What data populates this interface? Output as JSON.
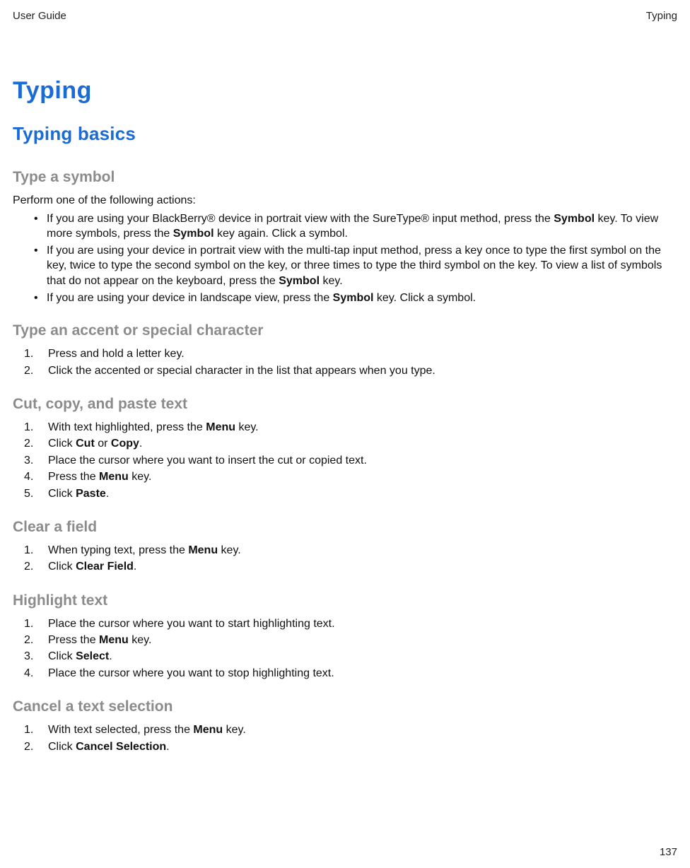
{
  "header": {
    "left": "User Guide",
    "right": "Typing"
  },
  "title": "Typing",
  "section": "Typing basics",
  "blocks": [
    {
      "heading": "Type a symbol",
      "intro": "Perform one of the following actions:",
      "bullets": [
        {
          "segments": [
            {
              "t": "If you are using your BlackBerry® device in portrait view with the SureType® input method, press the "
            },
            {
              "t": "Symbol",
              "b": true
            },
            {
              "t": " key. To view more symbols, press the "
            },
            {
              "t": "Symbol",
              "b": true
            },
            {
              "t": " key again. Click a symbol."
            }
          ]
        },
        {
          "segments": [
            {
              "t": "If you are using your device in portrait view with the multi-tap input method, press a key once to type the first symbol on the key, twice to type the second symbol on the key, or three times to type the third symbol on the key. To view a list of symbols that do not appear on the keyboard, press the "
            },
            {
              "t": "Symbol",
              "b": true
            },
            {
              "t": " key."
            }
          ]
        },
        {
          "segments": [
            {
              "t": "If you are using your device in landscape view, press the "
            },
            {
              "t": "Symbol",
              "b": true
            },
            {
              "t": " key. Click a symbol."
            }
          ]
        }
      ]
    },
    {
      "heading": "Type an accent or special character",
      "steps": [
        {
          "segments": [
            {
              "t": "Press and hold a letter key."
            }
          ]
        },
        {
          "segments": [
            {
              "t": "Click the accented or special character in the list that appears when you type."
            }
          ]
        }
      ]
    },
    {
      "heading": "Cut, copy, and paste text",
      "steps": [
        {
          "segments": [
            {
              "t": "With text highlighted, press the "
            },
            {
              "t": "Menu",
              "b": true
            },
            {
              "t": " key."
            }
          ]
        },
        {
          "segments": [
            {
              "t": "Click "
            },
            {
              "t": "Cut",
              "b": true
            },
            {
              "t": " or "
            },
            {
              "t": "Copy",
              "b": true
            },
            {
              "t": "."
            }
          ]
        },
        {
          "segments": [
            {
              "t": "Place the cursor where you want to insert the cut or copied text."
            }
          ]
        },
        {
          "segments": [
            {
              "t": "Press the "
            },
            {
              "t": "Menu",
              "b": true
            },
            {
              "t": " key."
            }
          ]
        },
        {
          "segments": [
            {
              "t": "Click "
            },
            {
              "t": "Paste",
              "b": true
            },
            {
              "t": "."
            }
          ]
        }
      ]
    },
    {
      "heading": "Clear a field",
      "steps": [
        {
          "segments": [
            {
              "t": "When typing text, press the "
            },
            {
              "t": "Menu",
              "b": true
            },
            {
              "t": " key."
            }
          ]
        },
        {
          "segments": [
            {
              "t": "Click "
            },
            {
              "t": "Clear Field",
              "b": true
            },
            {
              "t": "."
            }
          ]
        }
      ]
    },
    {
      "heading": "Highlight text",
      "steps": [
        {
          "segments": [
            {
              "t": "Place the cursor where you want to start highlighting text."
            }
          ]
        },
        {
          "segments": [
            {
              "t": "Press the "
            },
            {
              "t": "Menu",
              "b": true
            },
            {
              "t": " key."
            }
          ]
        },
        {
          "segments": [
            {
              "t": "Click "
            },
            {
              "t": "Select",
              "b": true
            },
            {
              "t": "."
            }
          ]
        },
        {
          "segments": [
            {
              "t": "Place the cursor where you want to stop highlighting text."
            }
          ]
        }
      ]
    },
    {
      "heading": "Cancel a text selection",
      "steps": [
        {
          "segments": [
            {
              "t": "With text selected, press the "
            },
            {
              "t": "Menu",
              "b": true
            },
            {
              "t": " key."
            }
          ]
        },
        {
          "segments": [
            {
              "t": "Click "
            },
            {
              "t": "Cancel Selection",
              "b": true
            },
            {
              "t": "."
            }
          ]
        }
      ]
    }
  ],
  "page_number": "137"
}
